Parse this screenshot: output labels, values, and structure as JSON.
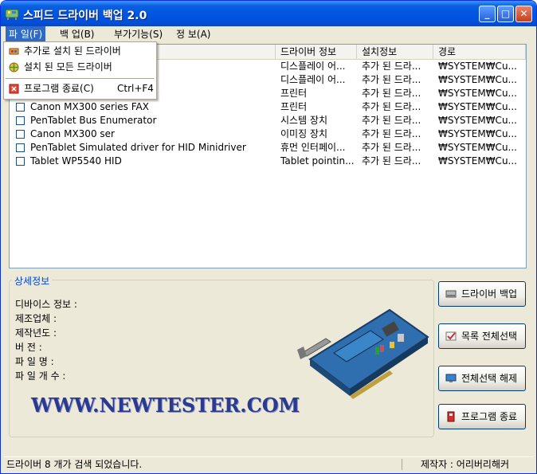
{
  "window": {
    "title": "스피드 드라이버 백업 2.0"
  },
  "menubar": {
    "items": [
      "파 일(F)",
      "백 업(B)",
      "부가기능(S)",
      "정 보(A)"
    ]
  },
  "file_menu": {
    "items": [
      {
        "label": "추가로 설치 된 드라이버",
        "shortcut": "",
        "icon": "driver-icon"
      },
      {
        "label": "설치 된 모든 드라이버",
        "shortcut": "",
        "icon": "globe-icon"
      },
      {
        "label": "프로그램 종료(C)",
        "shortcut": "Ctrl+F4",
        "icon": "exit-icon"
      }
    ]
  },
  "table": {
    "columns": [
      "",
      "드라이버 정보",
      "설치정보",
      "경로"
    ],
    "rows": [
      {
        "name": "Microsoft Corporation)",
        "info": "디스플레이 어...",
        "install": "추가 된 드라...",
        "path": "₩SYSTEM₩Cu..."
      },
      {
        "name": "osoft Corporation)",
        "info": "디스플레이 어...",
        "install": "추가 된 드라...",
        "path": "₩SYSTEM₩Cu..."
      },
      {
        "name": "",
        "info": "프린터",
        "install": "추가 된 드라...",
        "path": "₩SYSTEM₩Cu..."
      },
      {
        "name": "Canon MX300 series FAX",
        "info": "프린터",
        "install": "추가 된 드라...",
        "path": "₩SYSTEM₩Cu..."
      },
      {
        "name": "PenTablet Bus Enumerator",
        "info": "시스템 장치",
        "install": "추가 된 드라...",
        "path": "₩SYSTEM₩Cu..."
      },
      {
        "name": "Canon MX300 ser",
        "info": "이미징 장치",
        "install": "추가 된 드라...",
        "path": "₩SYSTEM₩Cu..."
      },
      {
        "name": "PenTablet Simulated driver for HID Minidriver",
        "info": "휴먼 인터페이...",
        "install": "추가 된 드라...",
        "path": "₩SYSTEM₩Cu..."
      },
      {
        "name": "Tablet WP5540 HID",
        "info": "Tablet pointin...",
        "install": "추가 된 드라...",
        "path": "₩SYSTEM₩Cu..."
      }
    ]
  },
  "details": {
    "title": "상세정보",
    "labels": [
      "디바이스 정보 :",
      "제조업체  :",
      "제작년도 :",
      "버    전 :",
      "파 일 명 :",
      "파 일 개 수 :"
    ]
  },
  "watermark": "WWW.NEWTESTER.COM",
  "buttons": {
    "backup": "드라이버 백업",
    "select_all": "목록 전체선택",
    "deselect_all": "전체선택 해제",
    "exit": "프로그램 종료"
  },
  "status": {
    "left": "드라이버 8 개가 검색 되었습니다.",
    "right": "제작자 : 어리버리해커"
  },
  "colors": {
    "title_bar": "#0054e3",
    "menu_highlight": "#316ac5",
    "group_title": "#0046d5"
  }
}
